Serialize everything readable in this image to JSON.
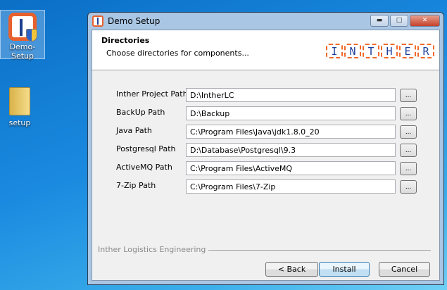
{
  "desktop": {
    "icons": [
      {
        "label": "Demo-Setup",
        "icon": "installer-shield-icon"
      },
      {
        "label": "setup",
        "icon": "folder-icon"
      }
    ]
  },
  "window": {
    "title": "Demo Setup",
    "controls": {
      "minimize": "minimize-icon",
      "maximize": "maximize-icon",
      "close": "close-icon"
    }
  },
  "header": {
    "title": "Directories",
    "subtitle": "Choose directories for components...",
    "logo_letters": [
      "I",
      "N",
      "T",
      "H",
      "E",
      "R"
    ]
  },
  "fields": [
    {
      "label": "Inther Project Path",
      "value": "D:\\IntherLC",
      "browse": "..."
    },
    {
      "label": "BackUp Path",
      "value": "D:\\Backup",
      "browse": "..."
    },
    {
      "label": "Java Path",
      "value": "C:\\Program Files\\Java\\jdk1.8.0_20",
      "browse": "..."
    },
    {
      "label": "Postgresql Path",
      "value": "D:\\Database\\Postgresql\\9.3",
      "browse": "..."
    },
    {
      "label": "ActiveMQ Path",
      "value": "C:\\Program Files\\ActiveMQ",
      "browse": "..."
    },
    {
      "label": "7-Zip Path",
      "value": "C:\\Program Files\\7-Zip",
      "browse": "..."
    }
  ],
  "footer": {
    "brand": "Inther Logistics Engineering",
    "back": "< Back",
    "install": "Install",
    "cancel": "Cancel"
  }
}
